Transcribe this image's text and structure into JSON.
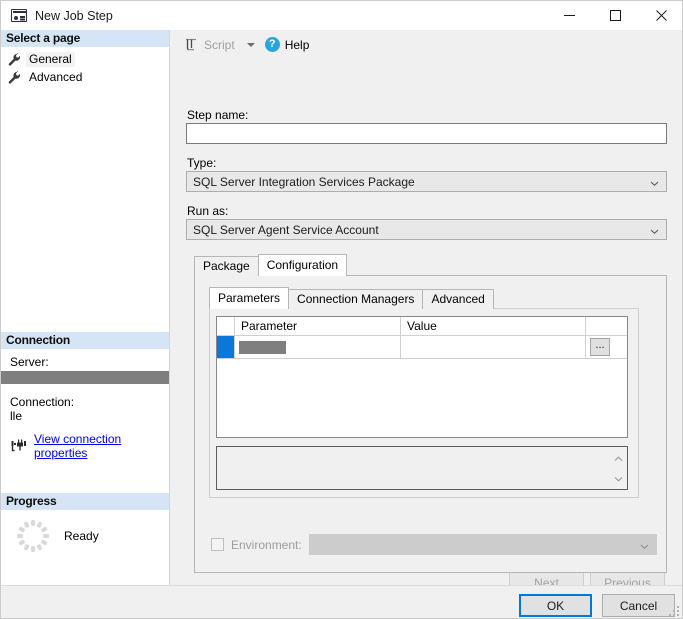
{
  "window": {
    "title": "New Job Step",
    "icon": "job-step-icon",
    "controls": {
      "minimize": "minimize-icon",
      "maximize": "maximize-icon",
      "close": "close-icon"
    }
  },
  "sidebar": {
    "select_page_heading": "Select a page",
    "pages": [
      {
        "label": "General",
        "icon": "wrench-icon",
        "selected": true
      },
      {
        "label": "Advanced",
        "icon": "wrench-icon",
        "selected": false
      }
    ],
    "connection": {
      "heading": "Connection",
      "server_label": "Server:",
      "server_value": "",
      "connection_label": "Connection:",
      "connection_value": "lle",
      "link_label": "View connection properties",
      "link_icon": "connection-properties-icon"
    },
    "progress": {
      "heading": "Progress",
      "status": "Ready",
      "icon": "progress-spinner-icon"
    }
  },
  "toolbar": {
    "script_label": "Script",
    "script_icon": "script-icon",
    "script_caret": "chevron-down-icon",
    "help_label": "Help",
    "help_icon": "help-icon"
  },
  "form": {
    "step_name_label": "Step name:",
    "step_name_value": "",
    "step_name_placeholder": "",
    "type_label": "Type:",
    "type_value": "SQL Server Integration Services Package",
    "run_as_label": "Run as:",
    "run_as_value": "SQL Server Agent Service Account"
  },
  "outer_tabs": [
    {
      "label": "Package",
      "active": false
    },
    {
      "label": "Configuration",
      "active": true
    }
  ],
  "inner_tabs": [
    {
      "label": "Parameters",
      "active": true
    },
    {
      "label": "Connection Managers",
      "active": false
    },
    {
      "label": "Advanced",
      "active": false
    }
  ],
  "grid": {
    "columns": [
      "",
      "Parameter",
      "Value",
      ""
    ],
    "rows": [
      {
        "selector": "",
        "parameter": "",
        "value": "",
        "browse_label": "..."
      }
    ]
  },
  "environment": {
    "checkbox_checked": false,
    "label": "Environment:",
    "value": ""
  },
  "nav_buttons": {
    "next": "Next",
    "previous": "Previous"
  },
  "dialog_buttons": {
    "ok": "OK",
    "cancel": "Cancel"
  },
  "colors": {
    "accent": "#0078d7",
    "row_selector": "#0c77d8",
    "section_header": "#d6e5f5",
    "redaction": "#7f7f7f",
    "help_blue": "#29a5de",
    "link": "#0000ee"
  }
}
